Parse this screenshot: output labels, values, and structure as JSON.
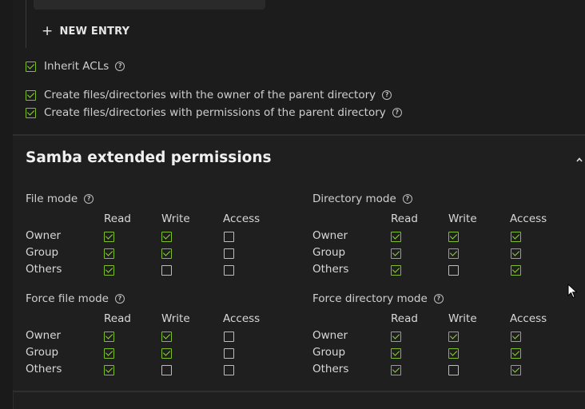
{
  "acl": {
    "new_entry_label": "NEW ENTRY",
    "options": [
      {
        "label": "Inherit ACLs",
        "checked": true
      },
      {
        "label": "Create files/directories with the owner of the parent directory",
        "checked": true
      },
      {
        "label": "Create files/directories with permissions of the parent directory",
        "checked": true
      }
    ]
  },
  "samba": {
    "title": "Samba extended permissions",
    "columns": [
      "Read",
      "Write",
      "Access"
    ],
    "rows": [
      "Owner",
      "Group",
      "Others"
    ],
    "modes": [
      {
        "title": "File mode",
        "grid": [
          [
            true,
            true,
            false
          ],
          [
            true,
            true,
            false
          ],
          [
            true,
            false,
            false
          ]
        ]
      },
      {
        "title": "Directory mode",
        "grid": [
          [
            true,
            true,
            true
          ],
          [
            true,
            true,
            true
          ],
          [
            true,
            false,
            true
          ]
        ]
      },
      {
        "title": "Force file mode",
        "grid": [
          [
            true,
            true,
            false
          ],
          [
            true,
            true,
            false
          ],
          [
            true,
            false,
            false
          ]
        ]
      },
      {
        "title": "Force directory mode",
        "grid": [
          [
            true,
            true,
            true
          ],
          [
            true,
            true,
            true
          ],
          [
            true,
            false,
            true
          ]
        ]
      }
    ]
  },
  "colors": {
    "accent": "#8fd13c",
    "background": "#1f1f1f",
    "text": "#d4d4d4"
  }
}
